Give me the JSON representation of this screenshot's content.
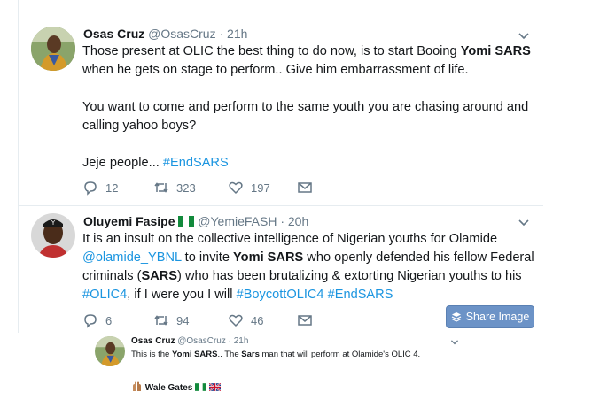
{
  "tweet1": {
    "name": "Osas Cruz",
    "handle": "@OsasCruz",
    "time": "· 21h",
    "line1_pre": "Those present at OLIC the best thing to do now, is to start Booing ",
    "line1_bold": "Yomi SARS",
    "line2": "when he gets on stage to perform.. Give him embarrassment of life.",
    "para2_line1": "You want to come and perform to the same youth you are chasing around and",
    "para2_line2": "calling yahoo boys?",
    "para3_pre": "Jeje people... ",
    "para3_tag": "#EndSARS",
    "replies": "12",
    "retweets": "323",
    "likes": "197"
  },
  "tweet2": {
    "name": "Oluyemi Fasipe",
    "handle": "@YemieFASH",
    "time": "· 20h",
    "l1": "It is an insult on the collective intelligence of Nigerian youths for Olamide",
    "l2_mention": "@olamide_YBNL",
    "l2_mid": " to invite ",
    "l2_bold": "Yomi SARS",
    "l2_post": " who openly defended his fellow Federal",
    "l3_pre": "criminals (",
    "l3_bold": "SARS",
    "l3_post": ") who has been brutalizing & extorting Nigerian youths to his",
    "l4_tag1": "#OLIC4",
    "l4_mid": ", if I were you I will ",
    "l4_tag2": "#BoycottOLIC4",
    "l4_sp": " ",
    "l4_tag3": "#EndSARS",
    "replies": "6",
    "retweets": "94",
    "likes": "46",
    "share_label": "Share Image"
  },
  "quoted": {
    "name": "Osas Cruz",
    "handle": "@OsasCruz",
    "time": "· 21h",
    "pre": "This is the ",
    "bold1": "Yomi SARS",
    "mid1": ".. The ",
    "bold2": "Sars",
    "post": " man that will perform at Olamide's OLIC 4.",
    "footer_name": "Wale Gates"
  },
  "colors": {
    "link": "#1b95e0",
    "muted": "#657786",
    "button": "#6c93c7"
  }
}
